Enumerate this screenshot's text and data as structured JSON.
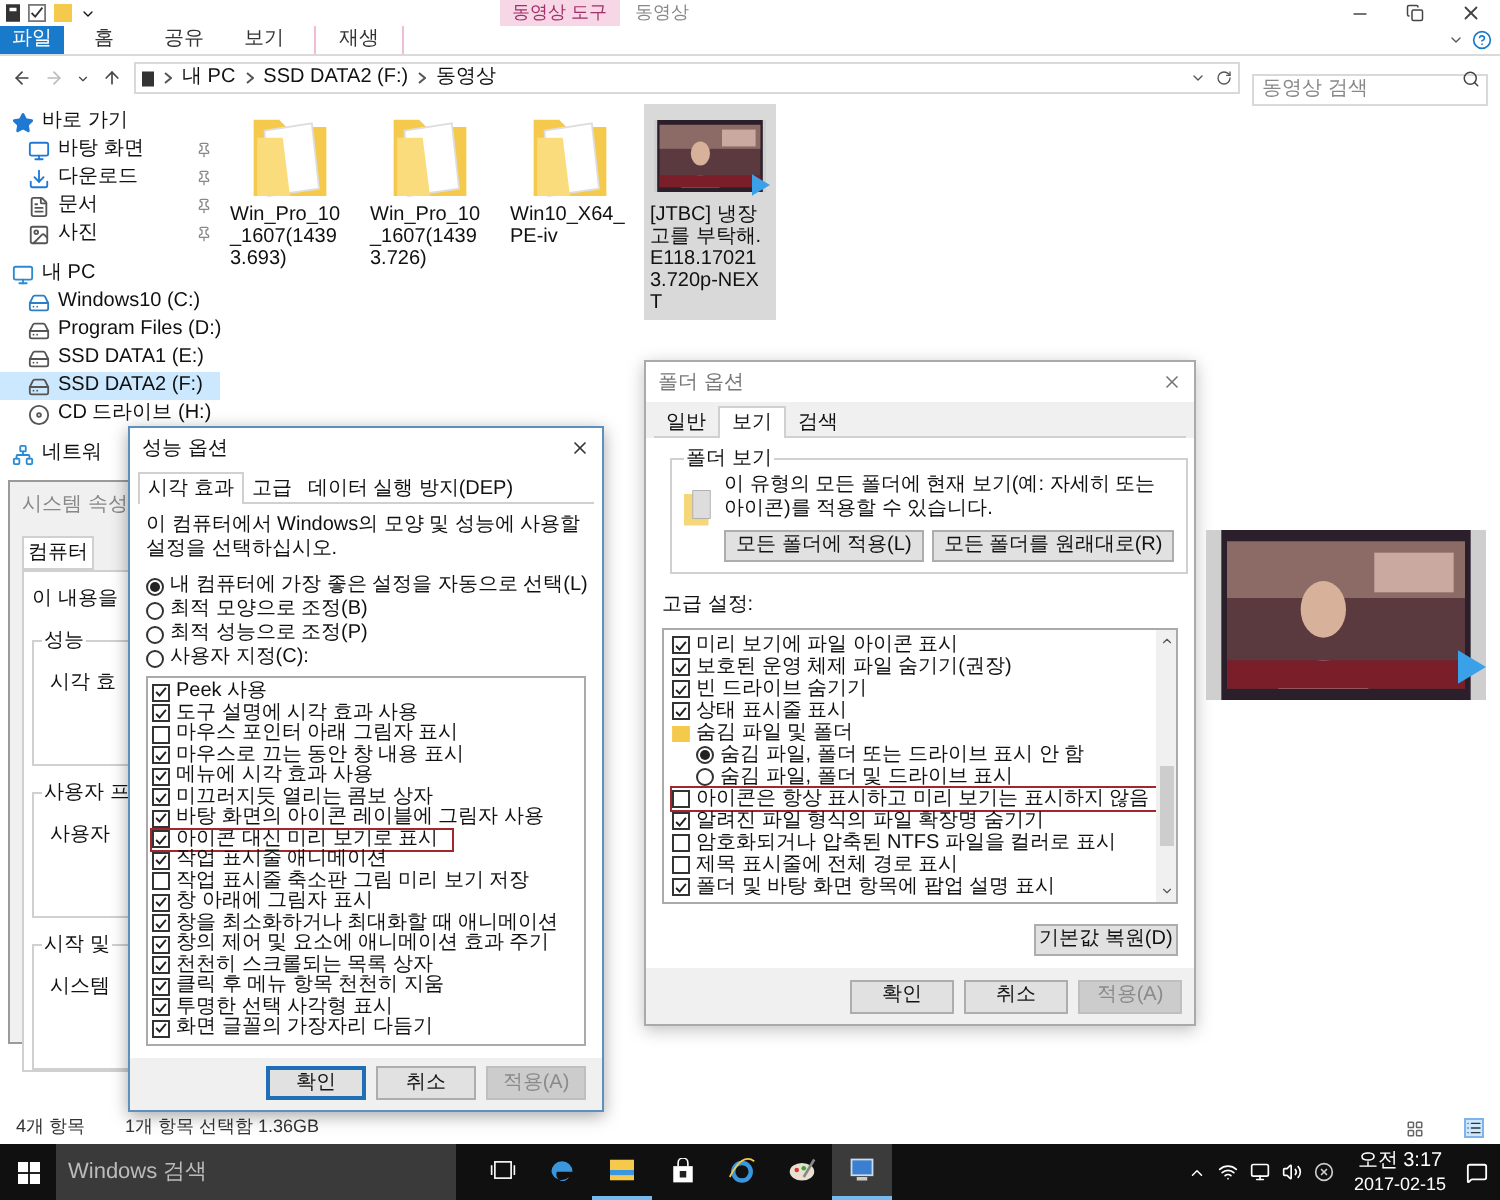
{
  "explorer": {
    "context_group": "동영상 도구",
    "title": "동영상",
    "ribbon_tabs": [
      {
        "label": "파일",
        "kind": "file"
      },
      {
        "label": "홈",
        "kind": "normal"
      },
      {
        "label": "공유",
        "kind": "normal"
      },
      {
        "label": "보기",
        "kind": "normal"
      },
      {
        "label": "재생",
        "kind": "context"
      }
    ],
    "address": [
      "내 PC",
      "SSD DATA2 (F:)",
      "동영상"
    ],
    "search": {
      "placeholder": "동영상 검색"
    },
    "nav": [
      {
        "label": "바로 가기",
        "kind": "star",
        "selected": false,
        "children": [
          {
            "label": "바탕 화면",
            "kind": "desktop",
            "selected": false,
            "pinned": true
          },
          {
            "label": "다운로드",
            "kind": "download",
            "selected": false,
            "pinned": true
          },
          {
            "label": "문서",
            "kind": "document",
            "selected": false,
            "pinned": true
          },
          {
            "label": "사진",
            "selected": false,
            "pinned": true
          }
        ]
      },
      {
        "label": "내 PC",
        "kind": "pc",
        "selected": false,
        "children": [
          {
            "label": "Windows10 (C:)",
            "kind": "system-drive",
            "selected": false
          },
          {
            "label": "Program Files (D:)",
            "kind": "drive",
            "selected": false
          },
          {
            "label": "SSD DATA1 (E:)",
            "kind": "drive",
            "selected": false
          },
          {
            "label": "SSD DATA2 (F:)",
            "kind": "drive",
            "selected": true
          },
          {
            "label": "CD 드라이브 (H:)",
            "kind": "cd",
            "selected": false
          }
        ]
      },
      {
        "label": "네트워",
        "kind": "network",
        "selected": false
      }
    ],
    "files": [
      {
        "name": "Win_Pro_10_1607(14393.693)",
        "kind": "folder",
        "selected": false
      },
      {
        "name": "Win_Pro_10_1607(14393.726)",
        "kind": "folder",
        "selected": false
      },
      {
        "name": "Win10_X64_PE-iv",
        "kind": "folder",
        "selected": false
      },
      {
        "name": "[JTBC] 냉장고를 부탁해.E118.170213.720p-NEXT",
        "kind": "video",
        "selected": true
      }
    ],
    "status": [
      "4개 항목",
      "1개 항목 선택함 1.36GB"
    ]
  },
  "system_properties": {
    "title": "시스템 속성",
    "tab": "컴퓨터",
    "intro": "이 내용을",
    "groups": [
      {
        "label": "성능",
        "text": "시각 효"
      },
      {
        "label": "사용자 프",
        "text": "사용자"
      },
      {
        "label": "시작 및",
        "text": "시스템"
      }
    ]
  },
  "performance_options": {
    "title": "성능 옵션",
    "tabs": [
      {
        "label": "시각 효과",
        "selected": true
      },
      {
        "label": "고급",
        "selected": false
      },
      {
        "label": "데이터 실행 방지(DEP)",
        "selected": false
      }
    ],
    "description": "이 컴퓨터에서 Windows의 모양 및 성능에 사용할 설정을 선택하십시오.",
    "radios": [
      {
        "label": "내 컴퓨터에 가장 좋은 설정을 자동으로 선택(L)",
        "selected": true
      },
      {
        "label": "최적 모양으로 조정(B)",
        "selected": false
      },
      {
        "label": "최적 성능으로 조정(P)",
        "selected": false
      },
      {
        "label": "사용자 지정(C):",
        "selected": false
      }
    ],
    "effects": [
      {
        "label": "Peek 사용",
        "checked": true,
        "highlighted": false
      },
      {
        "label": "도구 설명에 시각 효과 사용",
        "checked": true,
        "highlighted": false
      },
      {
        "label": "마우스 포인터 아래 그림자 표시",
        "checked": false,
        "highlighted": false
      },
      {
        "label": "마우스로 끄는 동안 창 내용 표시",
        "checked": true,
        "highlighted": false
      },
      {
        "label": "메뉴에 시각 효과 사용",
        "checked": true,
        "highlighted": false
      },
      {
        "label": "미끄러지듯 열리는 콤보 상자",
        "checked": true,
        "highlighted": false
      },
      {
        "label": "바탕 화면의 아이콘 레이블에 그림자 사용",
        "checked": true,
        "highlighted": false
      },
      {
        "label": "아이콘 대신 미리 보기로 표시",
        "checked": true,
        "highlighted": true
      },
      {
        "label": "작업 표시줄 애니메이션",
        "checked": true,
        "highlighted": false
      },
      {
        "label": "작업 표시줄 축소판 그림 미리 보기 저장",
        "checked": false,
        "highlighted": false
      },
      {
        "label": "창 아래에 그림자 표시",
        "checked": true,
        "highlighted": false
      },
      {
        "label": "창을 최소화하거나 최대화할 때 애니메이션",
        "checked": true,
        "highlighted": false
      },
      {
        "label": "창의 제어 및 요소에 애니메이션 효과 주기",
        "checked": true,
        "highlighted": false
      },
      {
        "label": "천천히 스크롤되는 목록 상자",
        "checked": true,
        "highlighted": false
      },
      {
        "label": "클릭 후 메뉴 항목 천천히 지움",
        "checked": true,
        "highlighted": false
      },
      {
        "label": "투명한 선택 사각형 표시",
        "checked": true,
        "highlighted": false
      },
      {
        "label": "화면 글꼴의 가장자리 다듬기",
        "checked": true,
        "highlighted": false
      }
    ],
    "buttons": [
      {
        "label": "확인",
        "default": true,
        "disabled": false
      },
      {
        "label": "취소",
        "default": false,
        "disabled": false
      },
      {
        "label": "적용(A)",
        "default": false,
        "disabled": true
      }
    ]
  },
  "folder_options": {
    "title": "폴더 옵션",
    "tabs": [
      {
        "label": "일반",
        "selected": false
      },
      {
        "label": "보기",
        "selected": true
      },
      {
        "label": "검색",
        "selected": false
      }
    ],
    "folder_views": {
      "label": "폴더 보기",
      "text": "이 유형의 모든 폴더에 현재 보기(예: 자세히 또는 아이콘)를 적용할 수 있습니다.",
      "buttons": [
        "모든 폴더에 적용(L)",
        "모든 폴더를 원래대로(R)"
      ]
    },
    "advanced_label": "고급 설정:",
    "settings": [
      {
        "kind": "checkbox",
        "label": "미리 보기에 파일 아이콘 표시",
        "checked": true,
        "highlighted": false
      },
      {
        "kind": "checkbox",
        "label": "보호된 운영 체제 파일 숨기기(권장)",
        "checked": true,
        "highlighted": false
      },
      {
        "kind": "checkbox",
        "label": "빈 드라이브 숨기기",
        "checked": true,
        "highlighted": false
      },
      {
        "kind": "checkbox",
        "label": "상태 표시줄 표시",
        "checked": true,
        "highlighted": false
      },
      {
        "kind": "folder",
        "label": "숨김 파일 및 폴더",
        "children": [
          {
            "kind": "radio",
            "label": "숨김 파일, 폴더 또는 드라이브 표시 안 함",
            "selected": true
          },
          {
            "kind": "radio",
            "label": "숨김 파일, 폴더 및 드라이브 표시",
            "selected": false
          }
        ]
      },
      {
        "kind": "checkbox",
        "label": "아이콘은 항상 표시하고 미리 보기는 표시하지 않음",
        "checked": false,
        "highlighted": true
      },
      {
        "kind": "checkbox",
        "label": "알려진 파일 형식의 파일 확장명 숨기기",
        "checked": true,
        "highlighted": false
      },
      {
        "kind": "checkbox",
        "label": "암호화되거나 압축된 NTFS 파일을 컬러로 표시",
        "checked": false,
        "highlighted": false
      },
      {
        "kind": "checkbox",
        "label": "제목 표시줄에 전체 경로 표시",
        "checked": false,
        "highlighted": false
      },
      {
        "kind": "checkbox",
        "label": "폴더 및 바탕 화면 항목에 팝업 설명 표시",
        "checked": true,
        "highlighted": false
      }
    ],
    "restore_button": "기본값 복원(D)",
    "buttons": [
      {
        "label": "확인",
        "default": false,
        "disabled": false
      },
      {
        "label": "취소",
        "default": false,
        "disabled": false
      },
      {
        "label": "적용(A)",
        "default": false,
        "disabled": true
      }
    ]
  },
  "taskbar": {
    "search": {
      "placeholder": "Windows 검색"
    },
    "apps": [
      {
        "kind": "task-view",
        "running": false,
        "active": false
      },
      {
        "kind": "edge",
        "running": false,
        "active": false
      },
      {
        "kind": "explorer",
        "running": true,
        "active": false
      },
      {
        "kind": "store",
        "running": false,
        "active": false
      },
      {
        "kind": "ie",
        "running": false,
        "active": false
      },
      {
        "kind": "paint",
        "running": false,
        "active": false
      },
      {
        "kind": "system",
        "running": true,
        "active": true
      }
    ],
    "time": "오전 3:17",
    "date": "2017-02-15"
  }
}
